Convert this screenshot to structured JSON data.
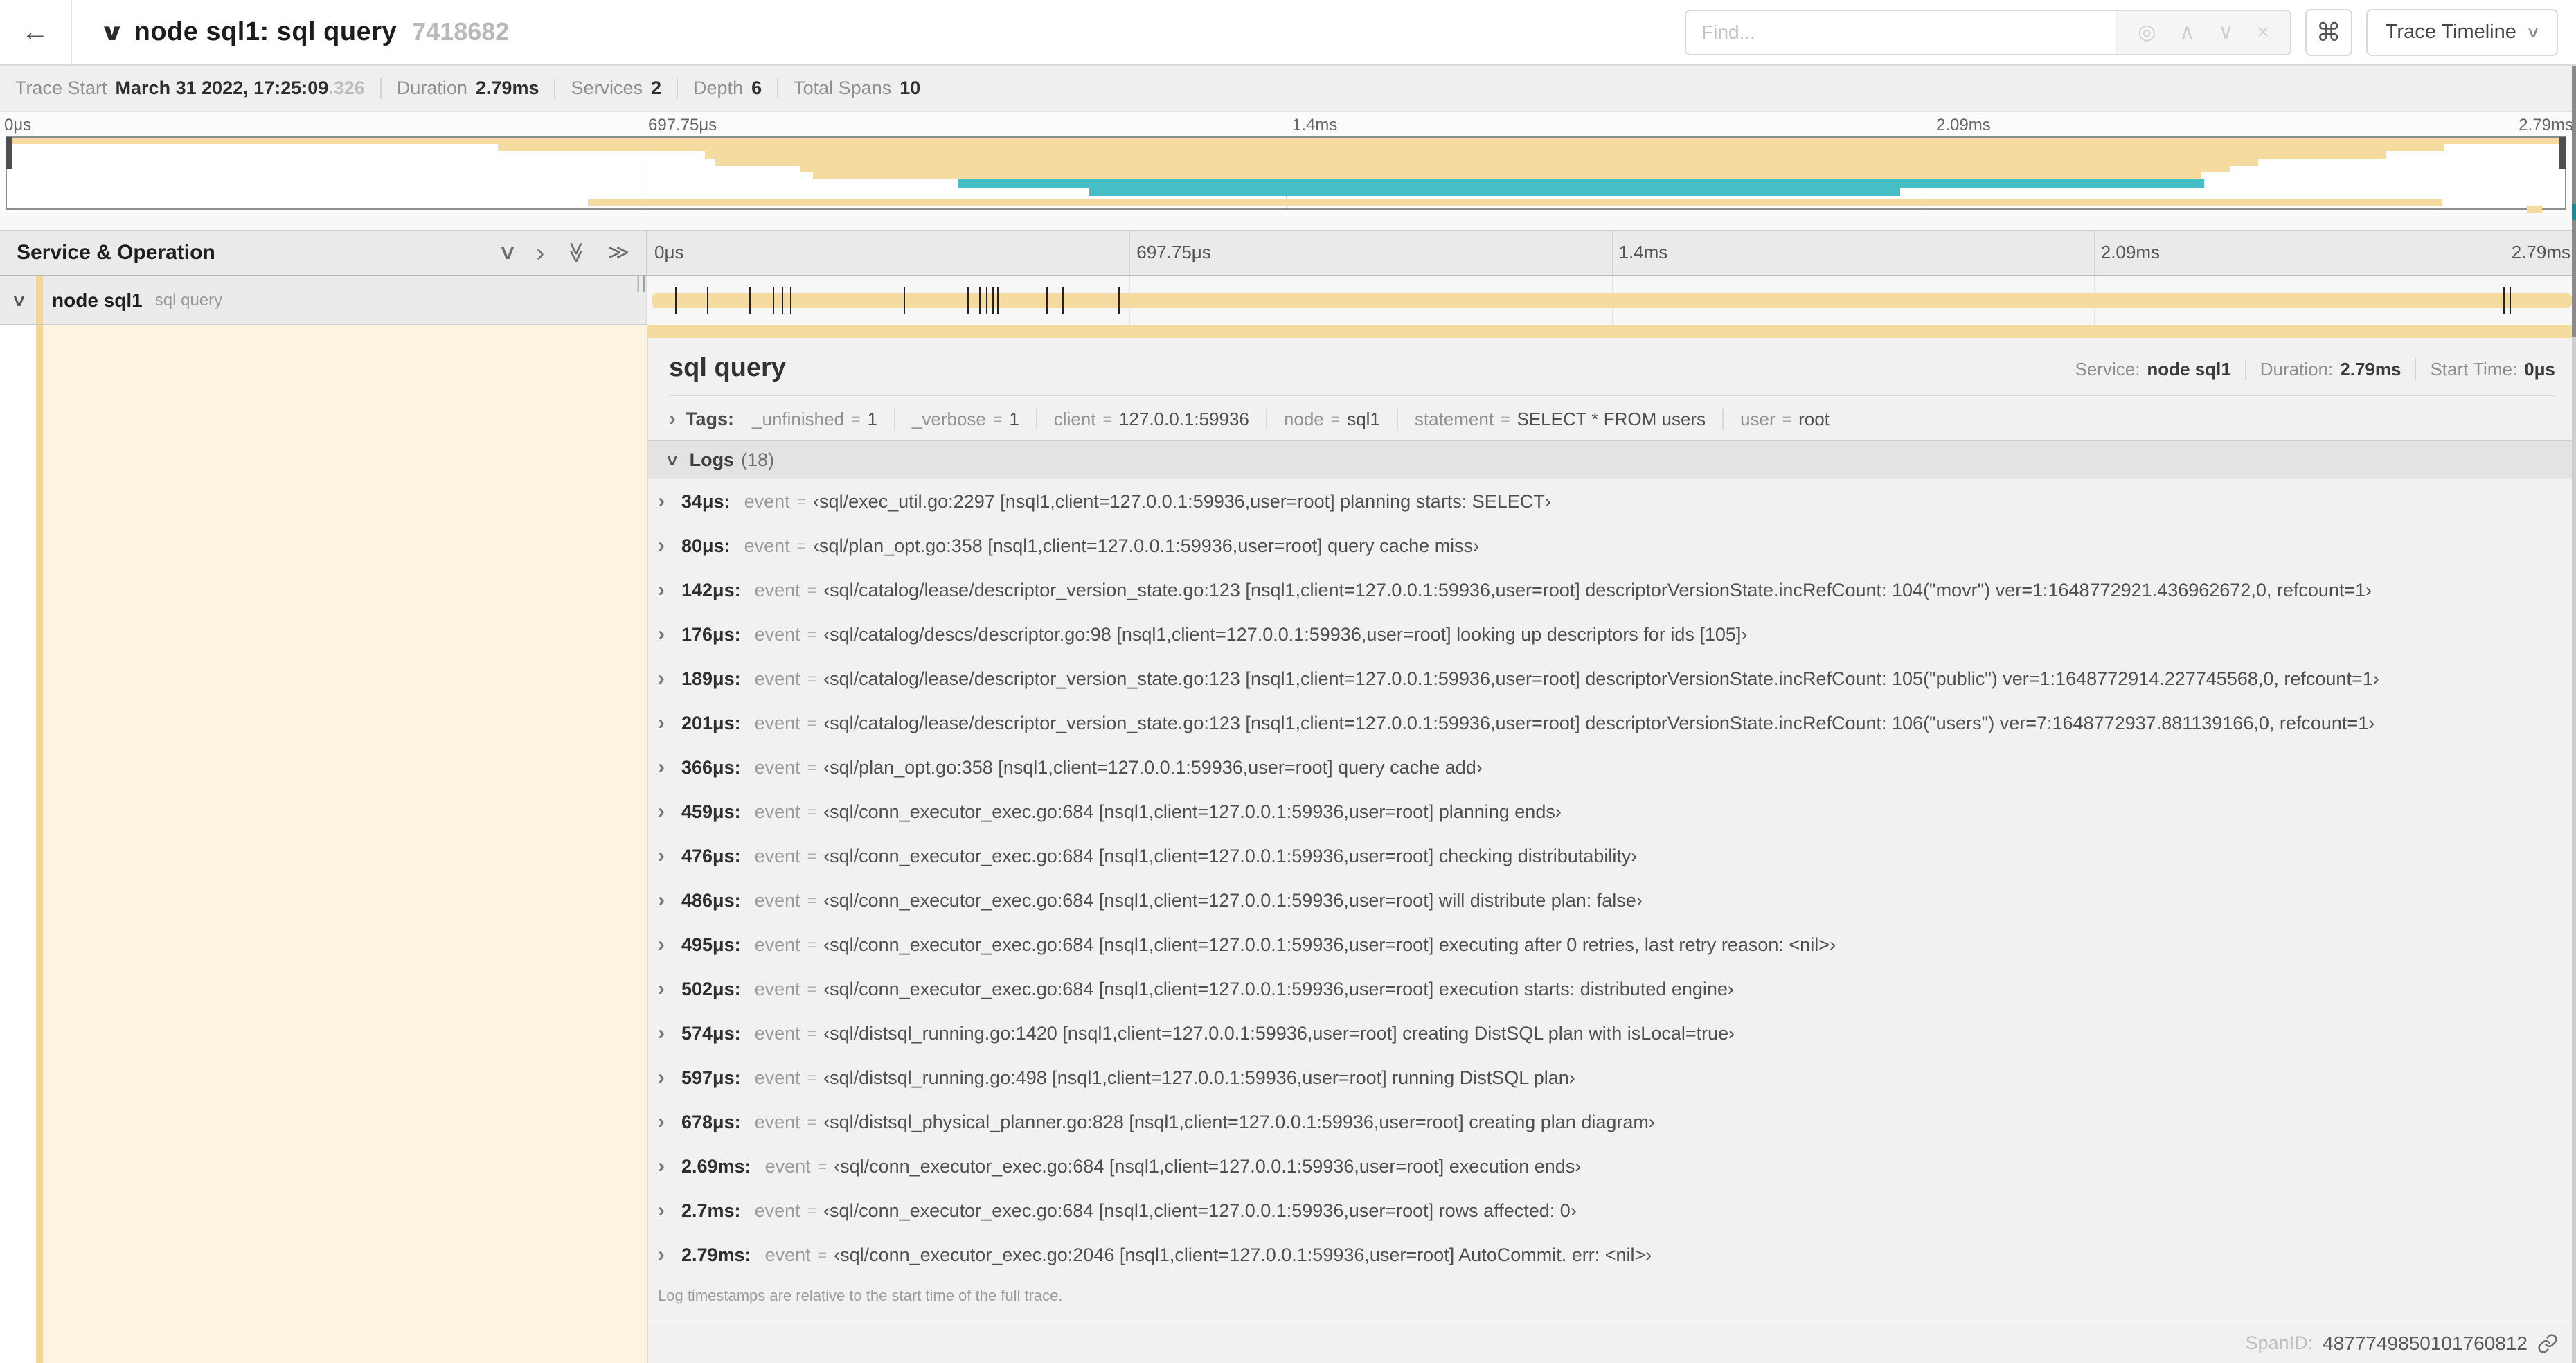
{
  "colors": {
    "span_yellow": "#f5dba0",
    "span_teal": "#45bec5",
    "accent_yellow": "#f5d692"
  },
  "header": {
    "title": "node sql1: sql query",
    "trace_id": "7418682",
    "find_placeholder": "Find...",
    "shortcut_glyph": "⌘",
    "view_select_label": "Trace Timeline"
  },
  "icons": {
    "back": "←",
    "chevron_down": "∨",
    "chevron_right": "›",
    "find_target": "◎",
    "find_prev": "∧",
    "find_next": "∨",
    "find_clear": "×",
    "collapse_one": "∨",
    "expand_one": "›",
    "collapse_all": "≫",
    "expand_all": "≫",
    "resizer": "||",
    "dropdown": "∨"
  },
  "summary": {
    "items": [
      {
        "label": "Trace Start",
        "value": "March 31 2022, 17:25:09",
        "suffix": ".326"
      },
      {
        "label": "Duration",
        "value": "2.79ms"
      },
      {
        "label": "Services",
        "value": "2"
      },
      {
        "label": "Depth",
        "value": "6"
      },
      {
        "label": "Total Spans",
        "value": "10"
      }
    ]
  },
  "minimap": {
    "ticks": [
      {
        "label": "0μs",
        "pct": 0
      },
      {
        "label": "697.75μs",
        "pct": 25
      },
      {
        "label": "1.4ms",
        "pct": 50
      },
      {
        "label": "2.09ms",
        "pct": 75
      },
      {
        "label": "2.79ms",
        "pct": 100,
        "align": "right"
      }
    ],
    "spans": [
      {
        "t": 0,
        "h": 9,
        "l": 0,
        "w": 100,
        "c": "y"
      },
      {
        "t": 9,
        "h": 10,
        "l": 19.2,
        "w": 76.1,
        "c": "y"
      },
      {
        "t": 19,
        "h": 10,
        "l": 27.3,
        "w": 65.7,
        "c": "y"
      },
      {
        "t": 29,
        "h": 10,
        "l": 27.7,
        "w": 60.3,
        "c": "y"
      },
      {
        "t": 39,
        "h": 10,
        "l": 31.0,
        "w": 55.9,
        "c": "y"
      },
      {
        "t": 49,
        "h": 10,
        "l": 31.5,
        "w": 54.3,
        "c": "y"
      },
      {
        "t": 59,
        "h": 13,
        "l": 37.2,
        "w": 48.7,
        "c": "t"
      },
      {
        "t": 72,
        "h": 10,
        "l": 42.3,
        "w": 31.7,
        "c": "t"
      },
      {
        "t": 86,
        "h": 11,
        "l": 22.7,
        "w": 72.5,
        "c": "y"
      },
      {
        "t": 97,
        "h": 9,
        "l": 98.5,
        "w": 0.6,
        "c": "y"
      }
    ]
  },
  "timeline": {
    "left_header": "Service & Operation",
    "ticks": [
      {
        "label": "0μs",
        "pct": 0
      },
      {
        "label": "697.75μs",
        "pct": 25
      },
      {
        "label": "1.4ms",
        "pct": 50
      },
      {
        "label": "2.09ms",
        "pct": 75
      },
      {
        "label": "2.79ms",
        "pct": 100,
        "align": "right"
      }
    ],
    "row": {
      "service": "node sql1",
      "operation": "sql query"
    },
    "log_tick_pcts": [
      1.22,
      2.87,
      5.09,
      6.31,
      6.77,
      7.2,
      13.12,
      16.45,
      17.06,
      17.42,
      17.74,
      17.99,
      20.57,
      21.4,
      24.3,
      96.42,
      96.77,
      100
    ]
  },
  "detail": {
    "title": "sql query",
    "meta": [
      {
        "label": "Service:",
        "value": "node sql1"
      },
      {
        "label": "Duration:",
        "value": "2.79ms"
      },
      {
        "label": "Start Time:",
        "value": "0μs"
      }
    ],
    "tags_label": "Tags:",
    "kv_separator": "=",
    "tags": [
      {
        "key": "_unfinished",
        "value": "1"
      },
      {
        "key": "_verbose",
        "value": "1"
      },
      {
        "key": "client",
        "value": "127.0.0.1:59936"
      },
      {
        "key": "node",
        "value": "sql1"
      },
      {
        "key": "statement",
        "value": "SELECT * FROM users"
      },
      {
        "key": "user",
        "value": "root"
      }
    ],
    "logs_label": "Logs",
    "logs_count": "(18)",
    "logs": [
      {
        "t": "34μs:",
        "key": "event",
        "value": "‹sql/exec_util.go:2297 [nsql1,client=127.0.0.1:59936,user=root] planning starts: SELECT›"
      },
      {
        "t": "80μs:",
        "key": "event",
        "value": "‹sql/plan_opt.go:358 [nsql1,client=127.0.0.1:59936,user=root] query cache miss›"
      },
      {
        "t": "142μs:",
        "key": "event",
        "value": "‹sql/catalog/lease/descriptor_version_state.go:123 [nsql1,client=127.0.0.1:59936,user=root] descriptorVersionState.incRefCount: 104(\"movr\") ver=1:1648772921.436962672,0, refcount=1›"
      },
      {
        "t": "176μs:",
        "key": "event",
        "value": "‹sql/catalog/descs/descriptor.go:98 [nsql1,client=127.0.0.1:59936,user=root] looking up descriptors for ids [105]›"
      },
      {
        "t": "189μs:",
        "key": "event",
        "value": "‹sql/catalog/lease/descriptor_version_state.go:123 [nsql1,client=127.0.0.1:59936,user=root] descriptorVersionState.incRefCount: 105(\"public\") ver=1:1648772914.227745568,0, refcount=1›"
      },
      {
        "t": "201μs:",
        "key": "event",
        "value": "‹sql/catalog/lease/descriptor_version_state.go:123 [nsql1,client=127.0.0.1:59936,user=root] descriptorVersionState.incRefCount: 106(\"users\") ver=7:1648772937.881139166,0, refcount=1›"
      },
      {
        "t": "366μs:",
        "key": "event",
        "value": "‹sql/plan_opt.go:358 [nsql1,client=127.0.0.1:59936,user=root] query cache add›"
      },
      {
        "t": "459μs:",
        "key": "event",
        "value": "‹sql/conn_executor_exec.go:684 [nsql1,client=127.0.0.1:59936,user=root] planning ends›"
      },
      {
        "t": "476μs:",
        "key": "event",
        "value": "‹sql/conn_executor_exec.go:684 [nsql1,client=127.0.0.1:59936,user=root] checking distributability›"
      },
      {
        "t": "486μs:",
        "key": "event",
        "value": "‹sql/conn_executor_exec.go:684 [nsql1,client=127.0.0.1:59936,user=root] will distribute plan: false›"
      },
      {
        "t": "495μs:",
        "key": "event",
        "value": "‹sql/conn_executor_exec.go:684 [nsql1,client=127.0.0.1:59936,user=root] executing after 0 retries, last retry reason: <nil>›"
      },
      {
        "t": "502μs:",
        "key": "event",
        "value": "‹sql/conn_executor_exec.go:684 [nsql1,client=127.0.0.1:59936,user=root] execution starts: distributed engine›"
      },
      {
        "t": "574μs:",
        "key": "event",
        "value": "‹sql/distsql_running.go:1420 [nsql1,client=127.0.0.1:59936,user=root] creating DistSQL plan with isLocal=true›"
      },
      {
        "t": "597μs:",
        "key": "event",
        "value": "‹sql/distsql_running.go:498 [nsql1,client=127.0.0.1:59936,user=root] running DistSQL plan›"
      },
      {
        "t": "678μs:",
        "key": "event",
        "value": "‹sql/distsql_physical_planner.go:828 [nsql1,client=127.0.0.1:59936,user=root] creating plan diagram›"
      },
      {
        "t": "2.69ms:",
        "key": "event",
        "value": "‹sql/conn_executor_exec.go:684 [nsql1,client=127.0.0.1:59936,user=root] execution ends›"
      },
      {
        "t": "2.7ms:",
        "key": "event",
        "value": "‹sql/conn_executor_exec.go:684 [nsql1,client=127.0.0.1:59936,user=root] rows affected: 0›"
      },
      {
        "t": "2.79ms:",
        "key": "event",
        "value": "‹sql/conn_executor_exec.go:2046 [nsql1,client=127.0.0.1:59936,user=root] AutoCommit. err: <nil>›"
      }
    ],
    "footer_note": "Log timestamps are relative to the start time of the full trace.",
    "spanid_label": "SpanID:",
    "spanid": "4877749850101760812"
  }
}
